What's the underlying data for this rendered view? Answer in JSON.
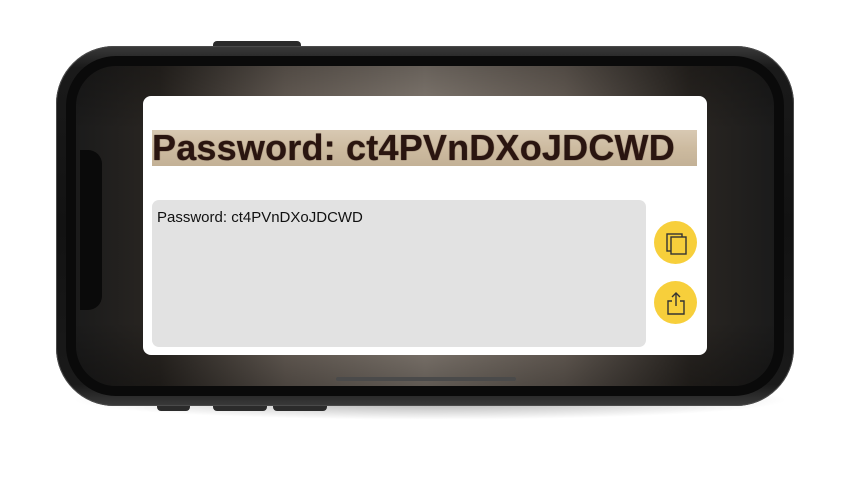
{
  "device": {
    "type": "phone",
    "orientation": "landscape"
  },
  "scan_result": {
    "captured_image_text": "Password: ct4PVnDXoJDCWD",
    "recognized_text": "Password: ct4PVnDXoJDCWD"
  },
  "actions": {
    "copy_icon": "copy-icon",
    "share_icon": "share-icon",
    "button_color": "#f7cf3b"
  }
}
